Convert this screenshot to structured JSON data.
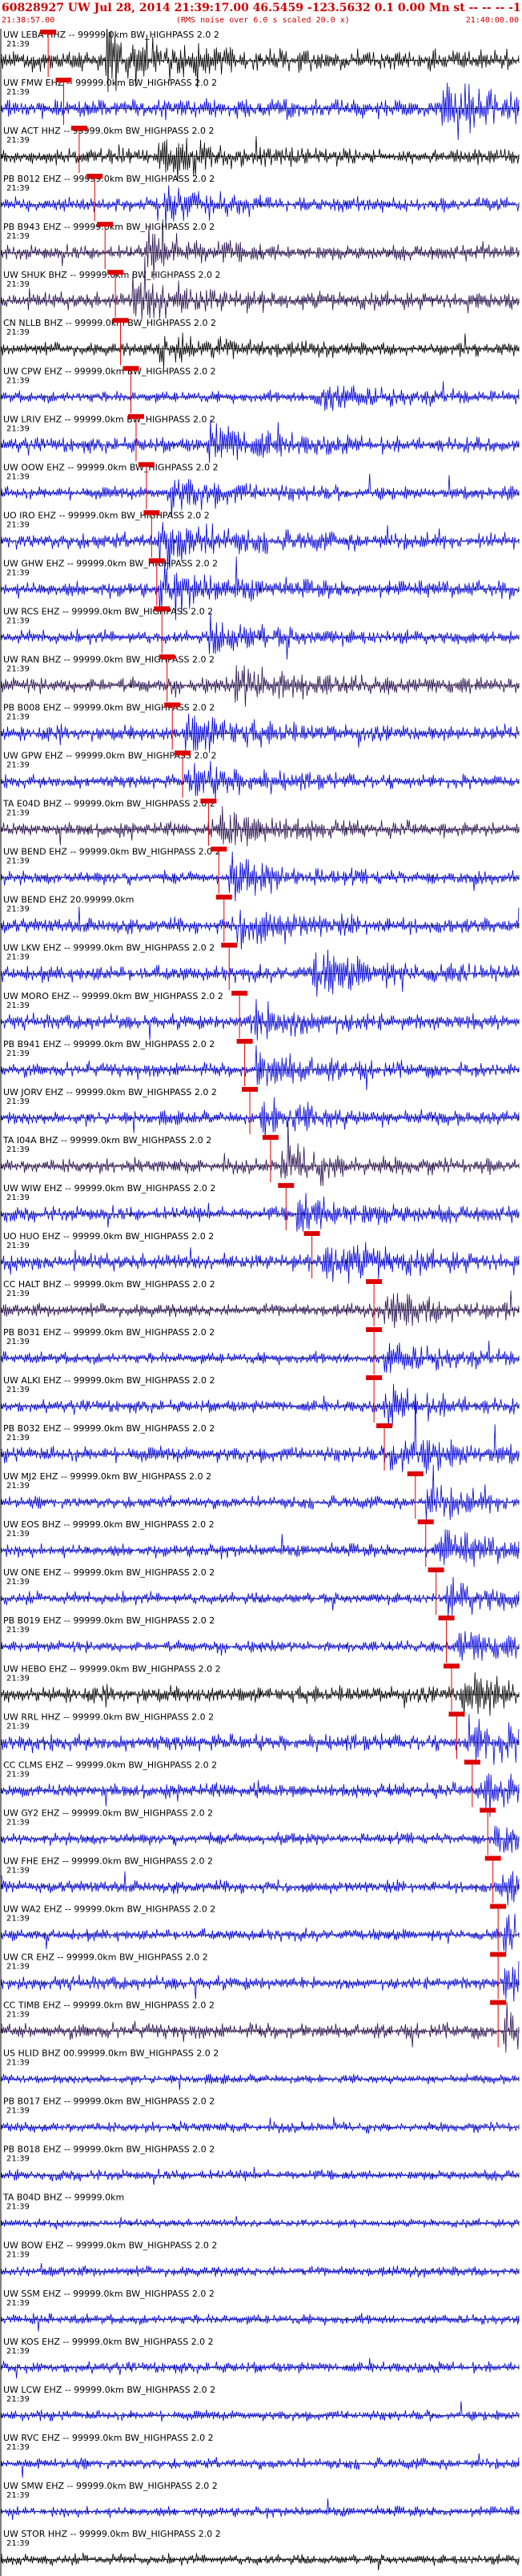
{
  "header": {
    "title": "60828927 UW Jul 28, 2014 21:39:17.00   46.5459 -123.5632  0.1 0.00 Mn st -- -- -- -1",
    "start_time": "21:38:57.00",
    "note": "(RMS noise over 6.0 s scaled 20.0 x)",
    "end_time": "21:40:00.00"
  },
  "colors": {
    "blue": "#0000dd",
    "black": "#000000",
    "dark": "#2a1050",
    "pick": "#dd0000"
  },
  "chart_data": {
    "type": "line",
    "title": "60828927 UW Jul 28, 2014 21:39:17.00   46.5459 -123.5632  0.1 0.00 Mn st -- -- -- -1",
    "xlabel": "",
    "ylabel": "",
    "x_range": [
      "21:38:57.00",
      "21:40:00.00"
    ],
    "row_time_label": "21:39",
    "grid": false,
    "series": [
      {
        "name": "UW LEBA HHZ -- 99999.0km BW_HIGHPASS 2.0 2",
        "color": "black",
        "amp": 0.75,
        "pick": 0.09,
        "burst": 0.2
      },
      {
        "name": "UW FMW EHZ -- 99999.0km BW_HIGHPASS 2.0 2",
        "color": "blue",
        "amp": 0.7,
        "pick": 0.12,
        "burst": 0.85
      },
      {
        "name": "UW ACT HHZ -- 99999.0km BW_HIGHPASS 2.0 2",
        "color": "black",
        "amp": 0.55,
        "pick": 0.15,
        "burst": 0.3
      },
      {
        "name": "PB B012 EHZ -- 99999.0km BW_HIGHPASS 2.0 2",
        "color": "blue",
        "amp": 0.5,
        "pick": 0.18,
        "burst": 0.3
      },
      {
        "name": "PB B943 EHZ -- 99999.0km BW_HIGHPASS 2.0 2",
        "color": "dark",
        "amp": 0.55,
        "pick": 0.2,
        "burst": 0.28
      },
      {
        "name": "UW SHUK BHZ -- 99999.0km BW_HIGHPASS 2.0 2",
        "color": "dark",
        "amp": 0.6,
        "pick": 0.22,
        "burst": 0.25
      },
      {
        "name": "CN NLLB BHZ -- 99999.0km BW_HIGHPASS 2.0 2",
        "color": "black",
        "amp": 0.5,
        "pick": 0.23,
        "burst": 0.3
      },
      {
        "name": "UW CPW EHZ -- 99999.0km BW_HIGHPASS 2.0 2",
        "color": "blue",
        "amp": 0.45,
        "pick": 0.25,
        "burst": 0.6
      },
      {
        "name": "UW LRIV EHZ -- 99999.0km BW_HIGHPASS 2.0 2",
        "color": "blue",
        "amp": 0.55,
        "pick": 0.26,
        "burst": 0.4
      },
      {
        "name": "UW OOW EHZ -- 99999.0km BW_HIGHPASS 2.0 2",
        "color": "blue",
        "amp": 0.5,
        "pick": 0.28,
        "burst": 0.32
      },
      {
        "name": "UO IRO EHZ -- 99999.0km BW_HIGHPASS 2.0 2",
        "color": "blue",
        "amp": 0.6,
        "pick": 0.29,
        "burst": 0.3
      },
      {
        "name": "UW GHW EHZ -- 99999.0km BW_HIGHPASS 2.0 2",
        "color": "blue",
        "amp": 0.6,
        "pick": 0.3,
        "burst": 0.3
      },
      {
        "name": "UW RCS EHZ -- 99999.0km BW_HIGHPASS 2.0 2",
        "color": "blue",
        "amp": 0.5,
        "pick": 0.31,
        "burst": 0.4
      },
      {
        "name": "UW RAN BHZ -- 99999.0km BW_HIGHPASS 2.0 2",
        "color": "dark",
        "amp": 0.6,
        "pick": 0.32,
        "burst": 0.45
      },
      {
        "name": "PB B008 EHZ -- 99999.0km BW_HIGHPASS 2.0 2",
        "color": "blue",
        "amp": 0.55,
        "pick": 0.33,
        "burst": 0.35
      },
      {
        "name": "UW GPW EHZ -- 99999.0km BW_HIGHPASS 2.0 2",
        "color": "blue",
        "amp": 0.5,
        "pick": 0.35,
        "burst": 0.36
      },
      {
        "name": "TA E04D BHZ -- 99999.0km BW_HIGHPASS 2.0 2",
        "color": "dark",
        "amp": 0.55,
        "pick": 0.4,
        "burst": 0.42
      },
      {
        "name": "UW BEND EHZ -- 99999.0km BW_HIGHPASS 2.0 2",
        "color": "blue",
        "amp": 0.5,
        "pick": 0.42,
        "burst": 0.44
      },
      {
        "name": "UW BEND EHZ 20.99999.0km",
        "color": "blue",
        "amp": 0.55,
        "pick": 0.43,
        "burst": 0.45
      },
      {
        "name": "UW LKW EHZ -- 99999.0km BW_HIGHPASS 2.0 2",
        "color": "blue",
        "amp": 0.6,
        "pick": 0.44,
        "burst": 0.6
      },
      {
        "name": "UW MORO EHZ -- 99999.0km BW_HIGHPASS 2.0 2",
        "color": "blue",
        "amp": 0.55,
        "pick": 0.46,
        "burst": 0.48
      },
      {
        "name": "PB B941 EHZ -- 99999.0km BW_HIGHPASS 2.0 2",
        "color": "blue",
        "amp": 0.5,
        "pick": 0.47,
        "burst": 0.49
      },
      {
        "name": "UW JORV EHZ -- 99999.0km BW_HIGHPASS 2.0 2",
        "color": "blue",
        "amp": 0.5,
        "pick": 0.48,
        "burst": 0.5
      },
      {
        "name": "TA I04A BHZ -- 99999.0km BW_HIGHPASS 2.0 2",
        "color": "dark",
        "amp": 0.55,
        "pick": 0.52,
        "burst": 0.54
      },
      {
        "name": "UW WIW EHZ -- 99999.0km BW_HIGHPASS 2.0 2",
        "color": "blue",
        "amp": 0.55,
        "pick": 0.55,
        "burst": 0.57
      },
      {
        "name": "UO HUO EHZ -- 99999.0km BW_HIGHPASS 2.0 2",
        "color": "blue",
        "amp": 0.6,
        "pick": 0.6,
        "burst": 0.62
      },
      {
        "name": "CC HALT BHZ -- 99999.0km BW_HIGHPASS 2.0 2",
        "color": "dark",
        "amp": 0.5,
        "pick": 0.72,
        "burst": 0.74
      },
      {
        "name": "PB B031 EHZ -- 99999.0km BW_HIGHPASS 2.0 2",
        "color": "blue",
        "amp": 0.45,
        "pick": 0.72,
        "burst": 0.74
      },
      {
        "name": "UW ALKI EHZ -- 99999.0km BW_HIGHPASS 2.0 2",
        "color": "blue",
        "amp": 0.45,
        "pick": 0.72,
        "burst": 0.74
      },
      {
        "name": "PB B032 EHZ -- 99999.0km BW_HIGHPASS 2.0 2",
        "color": "blue",
        "amp": 0.6,
        "pick": 0.74,
        "burst": 0.75
      },
      {
        "name": "UW MJ2 EHZ -- 99999.0km BW_HIGHPASS 2.0 2",
        "color": "blue",
        "amp": 0.45,
        "pick": 0.8,
        "burst": 0.82
      },
      {
        "name": "UW EOS BHZ -- 99999.0km BW_HIGHPASS 2.0 2",
        "color": "blue",
        "amp": 0.5,
        "pick": 0.82,
        "burst": 0.84
      },
      {
        "name": "UW ONE EHZ -- 99999.0km BW_HIGHPASS 2.0 2",
        "color": "blue",
        "amp": 0.45,
        "pick": 0.84,
        "burst": 0.86
      },
      {
        "name": "PB B019 EHZ -- 99999.0km BW_HIGHPASS 2.0 2",
        "color": "blue",
        "amp": 0.45,
        "pick": 0.86,
        "burst": 0.88
      },
      {
        "name": "UW HEBO EHZ -- 99999.0km BW_HIGHPASS 2.0 2",
        "color": "black",
        "amp": 0.6,
        "pick": 0.87,
        "burst": 0.89
      },
      {
        "name": "UW RRL HHZ -- 99999.0km BW_HIGHPASS 2.0 2",
        "color": "blue",
        "amp": 0.6,
        "pick": 0.88,
        "burst": 0.9
      },
      {
        "name": "CC CLMS EHZ -- 99999.0km BW_HIGHPASS 2.0 2",
        "color": "blue",
        "amp": 0.55,
        "pick": 0.91,
        "burst": 0.92
      },
      {
        "name": "UW GY2 EHZ -- 99999.0km BW_HIGHPASS 2.0 2",
        "color": "blue",
        "amp": 0.45,
        "pick": 0.94,
        "burst": 0.95
      },
      {
        "name": "UW FHE EHZ -- 99999.0km BW_HIGHPASS 2.0 2",
        "color": "blue",
        "amp": 0.45,
        "pick": 0.95,
        "burst": 0.96
      },
      {
        "name": "UW WA2 EHZ -- 99999.0km BW_HIGHPASS 2.0 2",
        "color": "blue",
        "amp": 0.45,
        "pick": 0.96,
        "burst": 0.97
      },
      {
        "name": "UW CR EHZ -- 99999.0km BW_HIGHPASS 2.0 2",
        "color": "blue",
        "amp": 0.5,
        "pick": 0.96,
        "burst": 0.97
      },
      {
        "name": "CC TIMB EHZ -- 99999.0km BW_HIGHPASS 2.0 2",
        "color": "dark",
        "amp": 0.55,
        "pick": 0.96,
        "burst": 0.97
      },
      {
        "name": "US HLID BHZ 00.99999.0km BW_HIGHPASS 2.0 2",
        "color": "blue",
        "amp": 0.35,
        "pick": null,
        "burst": null
      },
      {
        "name": "PB B017 EHZ -- 99999.0km BW_HIGHPASS 2.0 2",
        "color": "blue",
        "amp": 0.4,
        "pick": null,
        "burst": null
      },
      {
        "name": "PB B018 EHZ -- 99999.0km BW_HIGHPASS 2.0 2",
        "color": "blue",
        "amp": 0.4,
        "pick": null,
        "burst": null
      },
      {
        "name": "TA B04D BHZ -- 99999.0km",
        "color": "blue",
        "amp": 0.3,
        "pick": null,
        "burst": null
      },
      {
        "name": "UW BOW EHZ -- 99999.0km BW_HIGHPASS 2.0 2",
        "color": "blue",
        "amp": 0.4,
        "pick": null,
        "burst": null
      },
      {
        "name": "UW SSM EHZ -- 99999.0km BW_HIGHPASS 2.0 2",
        "color": "blue",
        "amp": 0.4,
        "pick": null,
        "burst": null
      },
      {
        "name": "UW KOS EHZ -- 99999.0km BW_HIGHPASS 2.0 2",
        "color": "blue",
        "amp": 0.4,
        "pick": null,
        "burst": null
      },
      {
        "name": "UW LCW EHZ -- 99999.0km BW_HIGHPASS 2.0 2",
        "color": "blue",
        "amp": 0.4,
        "pick": null,
        "burst": null
      },
      {
        "name": "UW RVC EHZ -- 99999.0km BW_HIGHPASS 2.0 2",
        "color": "blue",
        "amp": 0.4,
        "pick": null,
        "burst": null
      },
      {
        "name": "UW SMW EHZ -- 99999.0km BW_HIGHPASS 2.0 2",
        "color": "blue",
        "amp": 0.4,
        "pick": null,
        "burst": null
      },
      {
        "name": "UW STOR HHZ -- 99999.0km BW_HIGHPASS 2.0 2",
        "color": "black",
        "amp": 0.4,
        "pick": null,
        "burst": null
      }
    ]
  }
}
